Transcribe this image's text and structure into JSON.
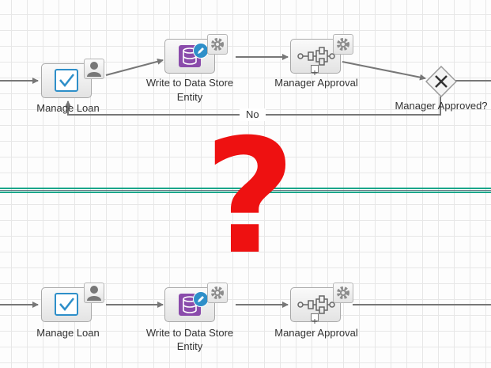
{
  "top_flow": {
    "manage_loan": "Manage Loan",
    "write_store_line1": "Write to Data Store",
    "write_store_line2": "Entity",
    "manager_approval": "Manager Approval",
    "gateway": "Manager Approved?",
    "no_label": "No"
  },
  "bottom_flow": {
    "manage_loan": "Manage Loan",
    "write_store_line1": "Write to Data Store",
    "write_store_line2": "Entity",
    "manager_approval": "Manager Approval"
  },
  "overlay": {
    "question_mark": "?"
  },
  "colors": {
    "question_mark": "#ee1111",
    "separator_green": "#1aa68a",
    "task_check": "#2e8fc9",
    "data_store": "#8a4bab"
  }
}
